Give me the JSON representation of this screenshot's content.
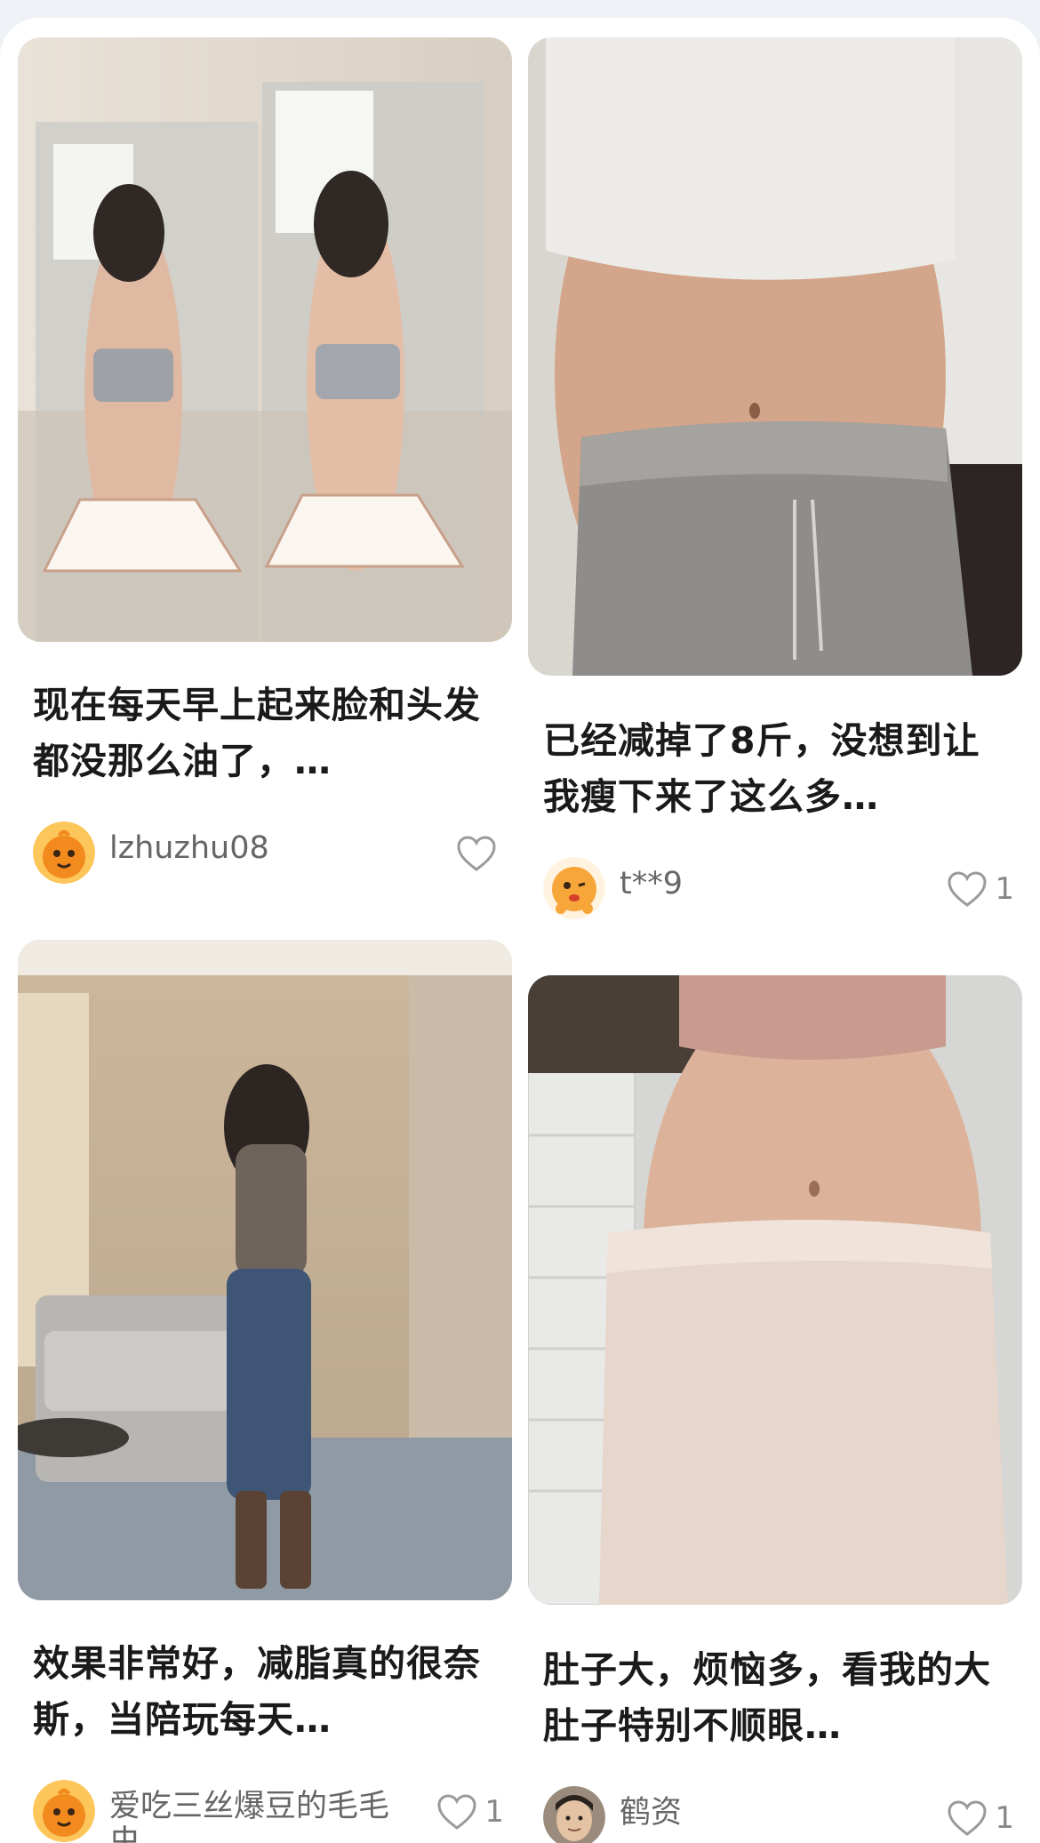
{
  "feed": {
    "cards": [
      {
        "title": "现在每天早上起来脸和头发都没那么油了，…",
        "author": "lzhuzhu08",
        "likes": "",
        "avatar_icon": "mascot-avatar-icon"
      },
      {
        "title": "已经减掉了8斤，没想到让我瘦下来了这么多…",
        "author": "t**9",
        "likes": "1",
        "avatar_icon": "mascot-avatar-icon"
      },
      {
        "title": "效果非常好，减脂真的很奈斯，当陪玩每天…",
        "author": "爱吃三丝爆豆的毛毛虫",
        "likes": "1",
        "avatar_icon": "mascot-avatar-icon"
      },
      {
        "title": "肚子大，烦恼多，看我的大肚子特别不顺眼…",
        "author": "鹤资",
        "likes": "1",
        "avatar_icon": "user-photo-avatar"
      }
    ]
  },
  "colors": {
    "background": "#eef1f5",
    "card_bg": "#ffffff",
    "title_text": "#1a1a1a",
    "author_text": "#666666",
    "heart_stroke": "#9a9a9a",
    "mascot_orange": "#f28a1e"
  }
}
